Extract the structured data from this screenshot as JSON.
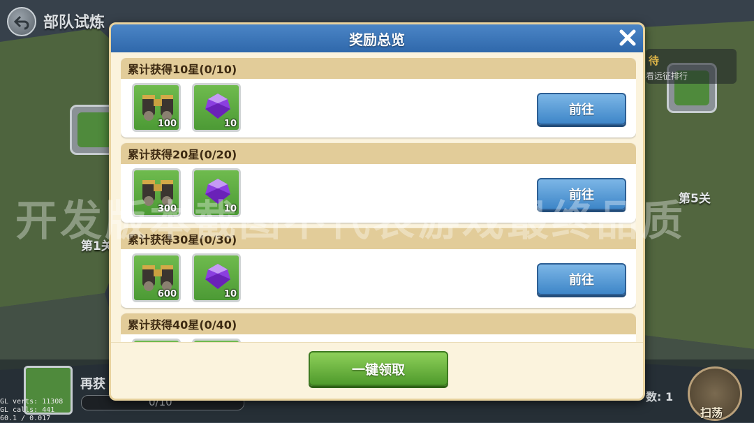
{
  "top_bar": {
    "title": "部队试炼"
  },
  "stages": {
    "left_label": "第1关",
    "right_label": "第5关"
  },
  "ranking": {
    "title": "待",
    "subtitle": "看远征排行"
  },
  "modal": {
    "title": "奖励总览",
    "rewards": [
      {
        "title": "累计获得10星(0/10)",
        "items": [
          {
            "icon": "binoculars-icon",
            "qty": "100"
          },
          {
            "icon": "purple-gem-icon",
            "qty": "10"
          }
        ],
        "button": "前往"
      },
      {
        "title": "累计获得20星(0/20)",
        "items": [
          {
            "icon": "binoculars-icon",
            "qty": "300"
          },
          {
            "icon": "purple-gem-icon",
            "qty": "10"
          }
        ],
        "button": "前往"
      },
      {
        "title": "累计获得30星(0/30)",
        "items": [
          {
            "icon": "binoculars-icon",
            "qty": "600"
          },
          {
            "icon": "purple-gem-icon",
            "qty": "10"
          }
        ],
        "button": "前往"
      },
      {
        "title": "累计获得40星(0/40)",
        "items": [
          {
            "icon": "binoculars-icon",
            "qty": ""
          },
          {
            "icon": "purple-gem-icon",
            "qty": ""
          }
        ],
        "button": ""
      }
    ],
    "claim_all": "一键领取"
  },
  "bottom": {
    "label": "再获",
    "progress": "0/10",
    "count": "数: 1",
    "sweep": "扫荡"
  },
  "debug": {
    "line1": "GL verts: 11308",
    "line2": "GL calls:   441",
    "line3": "60.1 / 0.017"
  },
  "watermark": "开发版本截图不代表游戏最终品质"
}
